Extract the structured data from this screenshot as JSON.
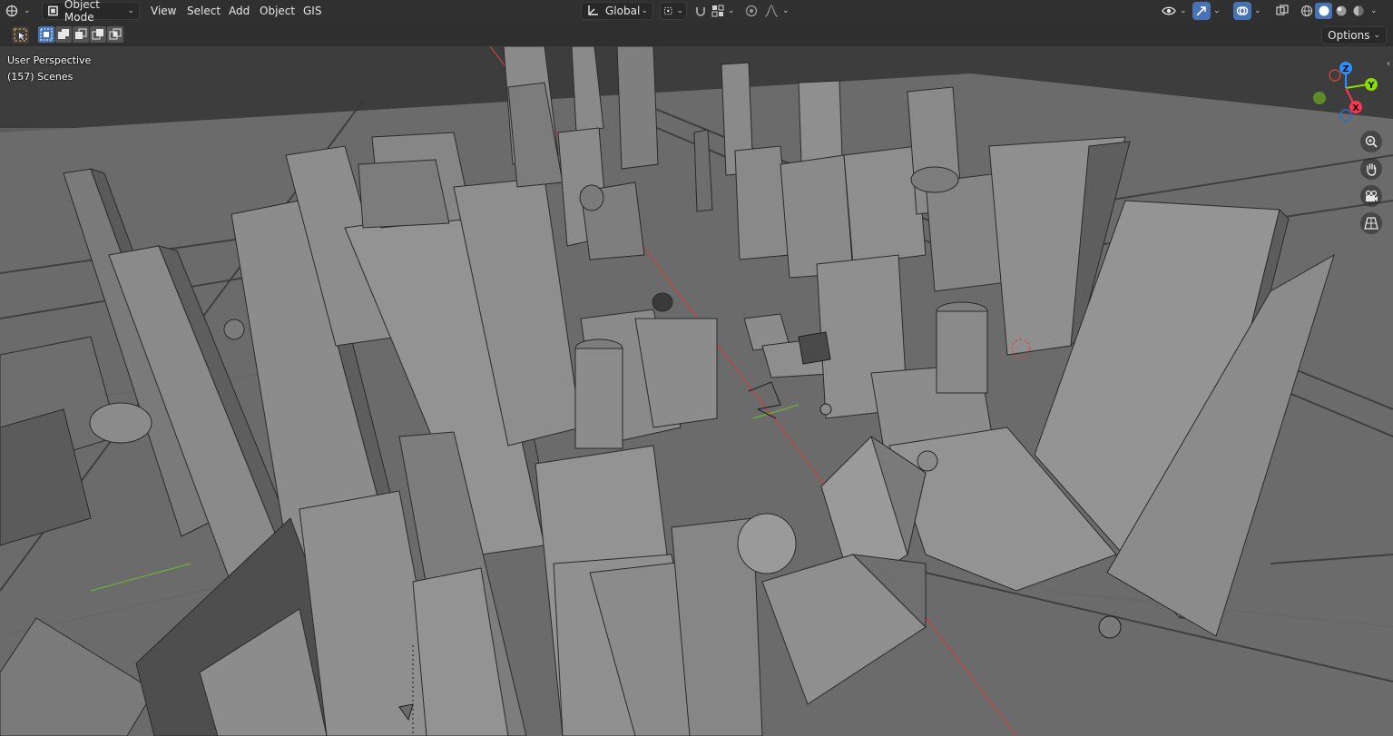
{
  "header": {
    "editor_type_icon": "globe-grid-icon",
    "mode": {
      "label": "Object Mode",
      "icon": "object-mode-icon"
    },
    "menus": [
      {
        "label": "View"
      },
      {
        "label": "Select"
      },
      {
        "label": "Add"
      },
      {
        "label": "Object"
      },
      {
        "label": "GIS"
      }
    ],
    "transform_orientation": {
      "label": "Global",
      "icon": "orientation-icon"
    },
    "pivot_icon": "pivot-point-icon",
    "snap_icon": "magnet-icon",
    "snap_target_icon": "snap-increment-icon",
    "proportional_icon": "proportional-edit-icon",
    "falloff_icon": "falloff-curve-icon",
    "visibility_icon": "eye-icon",
    "gizmo_icon": "gizmo-toggle-icon",
    "overlay_icon": "overlay-icon",
    "xray_icon": "xray-icon",
    "shading_modes": [
      "wireframe",
      "solid",
      "material",
      "rendered"
    ],
    "shading_active": "solid"
  },
  "toolbar": {
    "select_box_icon": "select-box-icon",
    "selection_modes": [
      "new",
      "extend",
      "subtract",
      "intersect",
      "invert"
    ],
    "options_label": "Options"
  },
  "viewport": {
    "perspective_label": "User Perspective",
    "collection_label": "(157) Scenes",
    "nav_icons": [
      "zoom-icon",
      "hand-icon",
      "camera-icon",
      "grid-view-icon"
    ],
    "axes": {
      "x": "X",
      "y": "Y",
      "z": "Z"
    },
    "colors": {
      "axis_x": "#ff3352",
      "axis_y": "#8bdc00",
      "axis_z": "#2890ff",
      "accent": "#4772b3"
    }
  }
}
